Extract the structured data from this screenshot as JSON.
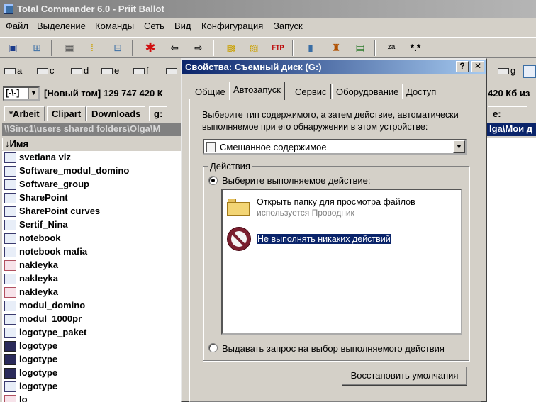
{
  "window": {
    "title": "Total Commander 6.0 - Priit Ballot"
  },
  "menu": [
    "Файл",
    "Выделение",
    "Команды",
    "Сеть",
    "Вид",
    "Конфигурация",
    "Запуск"
  ],
  "drives_left": [
    "a",
    "c",
    "d",
    "e",
    "f"
  ],
  "drives_right": [
    "g"
  ],
  "drive_combo": "[-\\-]",
  "volume_info": "[Новый том]  129 747 420 К",
  "volume_info_right": "420 Кб из",
  "folder_tabs": [
    "*Arbeit",
    "Clipart",
    "Downloads",
    "g:"
  ],
  "right_tab": "e:",
  "left_path": "\\\\Sinc1\\users shared folders\\Olga\\M",
  "right_path": "lga\\Мои д",
  "column_header": "↓Имя",
  "files": [
    {
      "name": "svetlana viz",
      "icon": "doc"
    },
    {
      "name": "Software_modul_domino",
      "icon": "doc"
    },
    {
      "name": "Software_group",
      "icon": "doc"
    },
    {
      "name": "SharePoint",
      "icon": "doc"
    },
    {
      "name": "SharePoint curves",
      "icon": "doc"
    },
    {
      "name": "Sertif_Nina",
      "icon": "doc"
    },
    {
      "name": "notebook",
      "icon": "doc"
    },
    {
      "name": "notebook mafia",
      "icon": "doc"
    },
    {
      "name": "nakleyka",
      "icon": "pdf"
    },
    {
      "name": "nakleyka",
      "icon": "doc"
    },
    {
      "name": "nakleyka",
      "icon": "pdf"
    },
    {
      "name": "modul_domino",
      "icon": "doc"
    },
    {
      "name": "modul_1000pr",
      "icon": "doc"
    },
    {
      "name": "logotype_paket",
      "icon": "doc"
    },
    {
      "name": "logotype",
      "icon": "img"
    },
    {
      "name": "logotype",
      "icon": "img"
    },
    {
      "name": "logotype",
      "icon": "img"
    },
    {
      "name": "logotype",
      "icon": "doc"
    },
    {
      "name": "lo",
      "icon": "pdf"
    }
  ],
  "dialog": {
    "title": "Свойства: Съемный диск (G:)",
    "help_btn": "?",
    "close_btn": "✕",
    "tabs": [
      "Общие",
      "Автозапуск",
      "Сервис",
      "Оборудование",
      "Доступ"
    ],
    "active_tab": "Автозапуск",
    "content_label": "Выберите тип содержимого, а затем действие, автоматически выполняемое при его обнаружении в этом устройстве:",
    "content_type": "Смешанное содержимое",
    "group_label": "Действия",
    "radio_select_action": "Выберите выполняемое действие:",
    "action_open_folder": "Открыть папку для просмотра файлов",
    "action_open_folder_sub": "используется Проводник",
    "action_none": "Не выполнять никаких действий",
    "radio_prompt": "Выдавать запрос на выбор выполняемого действия",
    "restore_button": "Восстановить умолчания"
  }
}
